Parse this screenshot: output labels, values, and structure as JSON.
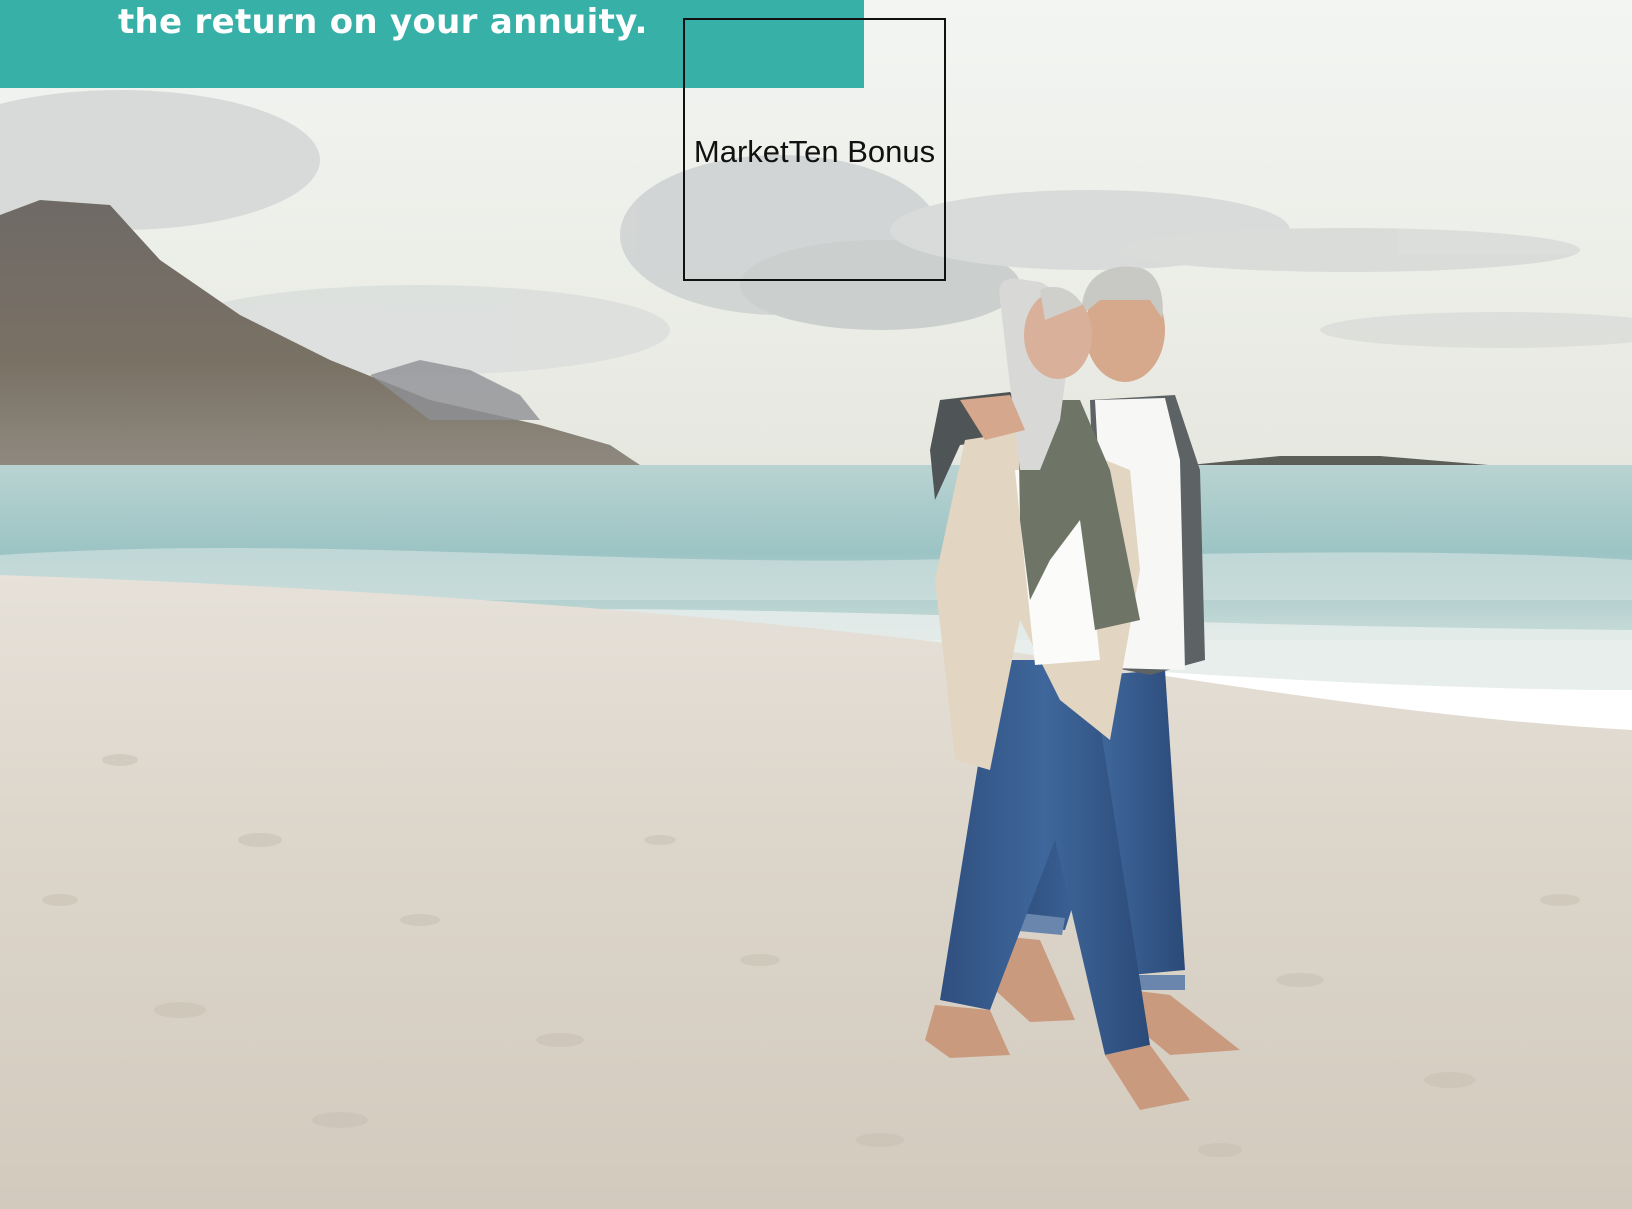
{
  "banner": {
    "headline": "the return on your annuity.",
    "background_color": "#37b0a8",
    "text_color": "#ffffff"
  },
  "image_placeholder": {
    "label": "MarketTen Bonus"
  },
  "photo": {
    "subject": "couple-walking-on-beach",
    "scene": [
      "sky",
      "clouds",
      "mountain",
      "ocean",
      "sand",
      "couple"
    ]
  }
}
